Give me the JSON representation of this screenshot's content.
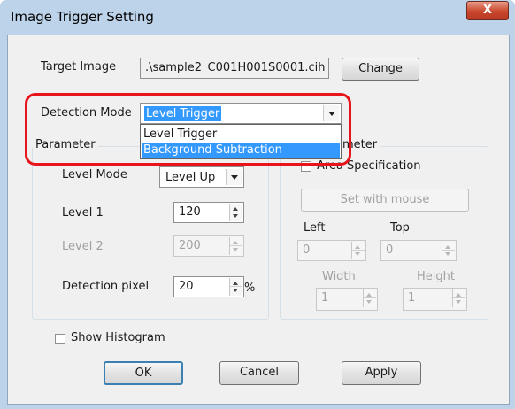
{
  "window": {
    "title": "Image Trigger Setting",
    "close_glyph": "X"
  },
  "target": {
    "label": "Target Image",
    "value": ".\\sample2_C001H001S0001.cih )",
    "change_label": "Change"
  },
  "detection": {
    "label": "Detection Mode",
    "selected": "Level Trigger",
    "options": [
      "Level Trigger",
      "Background Subtraction"
    ],
    "highlighted_option": "Background Subtraction"
  },
  "parameter": {
    "title": "Parameter",
    "level_mode": {
      "label": "Level Mode",
      "value": "Level Up"
    },
    "level1": {
      "label": "Level 1",
      "value": "120"
    },
    "level2": {
      "label": "Level 2",
      "value": "200"
    },
    "detection_pixel": {
      "label": "Detection pixel",
      "value": "20",
      "unit": "%"
    }
  },
  "area": {
    "title_partial": "ameter",
    "area_spec_label": "Area Specification",
    "set_with_mouse": "Set with mouse",
    "left": {
      "label": "Left",
      "value": "0"
    },
    "top": {
      "label": "Top",
      "value": "0"
    },
    "width": {
      "label": "Width",
      "value": "1"
    },
    "height": {
      "label": "Height",
      "value": "1"
    }
  },
  "show_histogram": {
    "label": "Show Histogram",
    "checked": false
  },
  "buttons": {
    "ok": "OK",
    "cancel": "Cancel",
    "apply": "Apply"
  },
  "colors": {
    "highlight_border": "#e8141b",
    "selection": "#3399ff",
    "title_bar": "#bdd3ea"
  }
}
